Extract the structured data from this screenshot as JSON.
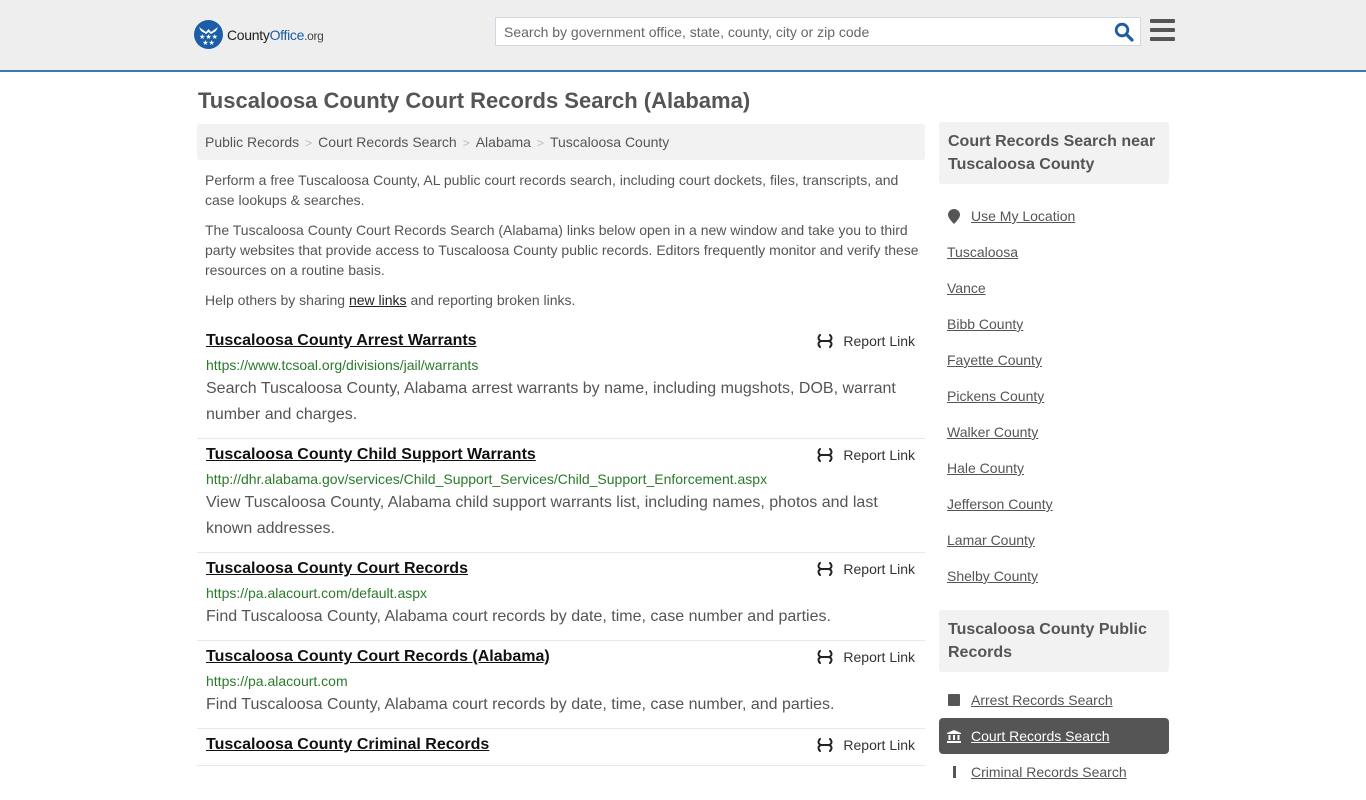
{
  "header": {
    "logo": {
      "name": "County",
      "accent": "Office",
      "tld": ".org"
    },
    "search": {
      "placeholder": "Search by government office, state, county, city or zip code",
      "value": ""
    },
    "search_icon": "search-icon",
    "menu_icon": "hamburger-menu-icon"
  },
  "colors": {
    "brand_blue": "#1b5da6",
    "header_border": "#3a7bb0",
    "url_green": "#2a7a2a",
    "active_item_bg": "#555555"
  },
  "page": {
    "title": "Tuscaloosa County Court Records Search (Alabama)",
    "breadcrumb": [
      "Public Records",
      "Court Records Search",
      "Alabama",
      "Tuscaloosa County"
    ],
    "breadcrumb_separator": ">",
    "intro": {
      "p1": "Perform a free Tuscaloosa County, AL public court records search, including court dockets, files, transcripts, and case lookups & searches.",
      "p2": "The Tuscaloosa County Court Records Search (Alabama) links below open in a new window and take you to third party websites that provide access to Tuscaloosa County public records. Editors frequently monitor and verify these resources on a routine basis.",
      "p3_before": "Help others by sharing ",
      "p3_link": "new links",
      "p3_after": " and reporting broken links."
    }
  },
  "results": [
    {
      "title": "Tuscaloosa County Arrest Warrants",
      "url": "https://www.tcsoal.org/divisions/jail/warrants",
      "description": "Search Tuscaloosa County, Alabama arrest warrants by name, including mugshots, DOB, warrant number and charges.",
      "report_label": "Report Link"
    },
    {
      "title": "Tuscaloosa County Child Support Warrants",
      "url": "http://dhr.alabama.gov/services/Child_Support_Services/Child_Support_Enforcement.aspx",
      "description": "View Tuscaloosa County, Alabama child support warrants list, including names, photos and last known addresses.",
      "report_label": "Report Link"
    },
    {
      "title": "Tuscaloosa County Court Records",
      "url": "https://pa.alacourt.com/default.aspx",
      "description": "Find Tuscaloosa County, Alabama court records by date, time, case number and parties.",
      "report_label": "Report Link"
    },
    {
      "title": "Tuscaloosa County Court Records (Alabama)",
      "url": "https://pa.alacourt.com",
      "description": "Find Tuscaloosa County, Alabama court records by date, time, case number, and parties.",
      "report_label": "Report Link"
    },
    {
      "title": "Tuscaloosa County Criminal Records",
      "url": "",
      "description": "",
      "report_label": "Report Link"
    }
  ],
  "sidebar": {
    "nearby": {
      "heading": "Court Records Search near Tuscaloosa County",
      "use_location": "Use My Location",
      "items": [
        "Tuscaloosa",
        "Vance",
        "Bibb County",
        "Fayette County",
        "Pickens County",
        "Walker County",
        "Hale County",
        "Jefferson County",
        "Lamar County",
        "Shelby County"
      ]
    },
    "public_records": {
      "heading": "Tuscaloosa County Public Records",
      "items": [
        {
          "label": "Arrest Records Search",
          "icon": "square-icon",
          "active": false
        },
        {
          "label": "Court Records Search",
          "icon": "courthouse-icon",
          "active": true
        },
        {
          "label": "Criminal Records Search",
          "icon": "exclamation-icon",
          "active": false
        }
      ]
    }
  }
}
